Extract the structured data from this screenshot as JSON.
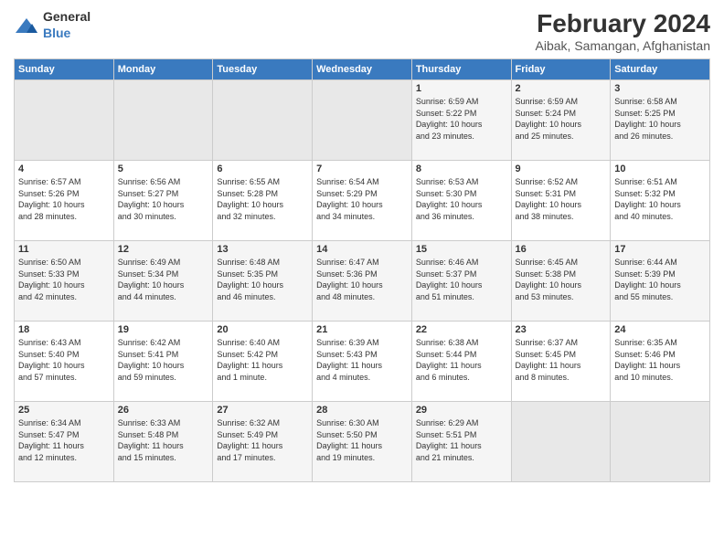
{
  "logo": {
    "general": "General",
    "blue": "Blue"
  },
  "header": {
    "month": "February 2024",
    "location": "Aibak, Samangan, Afghanistan"
  },
  "weekdays": [
    "Sunday",
    "Monday",
    "Tuesday",
    "Wednesday",
    "Thursday",
    "Friday",
    "Saturday"
  ],
  "weeks": [
    [
      {
        "day": "",
        "info": ""
      },
      {
        "day": "",
        "info": ""
      },
      {
        "day": "",
        "info": ""
      },
      {
        "day": "",
        "info": ""
      },
      {
        "day": "1",
        "info": "Sunrise: 6:59 AM\nSunset: 5:22 PM\nDaylight: 10 hours\nand 23 minutes."
      },
      {
        "day": "2",
        "info": "Sunrise: 6:59 AM\nSunset: 5:24 PM\nDaylight: 10 hours\nand 25 minutes."
      },
      {
        "day": "3",
        "info": "Sunrise: 6:58 AM\nSunset: 5:25 PM\nDaylight: 10 hours\nand 26 minutes."
      }
    ],
    [
      {
        "day": "4",
        "info": "Sunrise: 6:57 AM\nSunset: 5:26 PM\nDaylight: 10 hours\nand 28 minutes."
      },
      {
        "day": "5",
        "info": "Sunrise: 6:56 AM\nSunset: 5:27 PM\nDaylight: 10 hours\nand 30 minutes."
      },
      {
        "day": "6",
        "info": "Sunrise: 6:55 AM\nSunset: 5:28 PM\nDaylight: 10 hours\nand 32 minutes."
      },
      {
        "day": "7",
        "info": "Sunrise: 6:54 AM\nSunset: 5:29 PM\nDaylight: 10 hours\nand 34 minutes."
      },
      {
        "day": "8",
        "info": "Sunrise: 6:53 AM\nSunset: 5:30 PM\nDaylight: 10 hours\nand 36 minutes."
      },
      {
        "day": "9",
        "info": "Sunrise: 6:52 AM\nSunset: 5:31 PM\nDaylight: 10 hours\nand 38 minutes."
      },
      {
        "day": "10",
        "info": "Sunrise: 6:51 AM\nSunset: 5:32 PM\nDaylight: 10 hours\nand 40 minutes."
      }
    ],
    [
      {
        "day": "11",
        "info": "Sunrise: 6:50 AM\nSunset: 5:33 PM\nDaylight: 10 hours\nand 42 minutes."
      },
      {
        "day": "12",
        "info": "Sunrise: 6:49 AM\nSunset: 5:34 PM\nDaylight: 10 hours\nand 44 minutes."
      },
      {
        "day": "13",
        "info": "Sunrise: 6:48 AM\nSunset: 5:35 PM\nDaylight: 10 hours\nand 46 minutes."
      },
      {
        "day": "14",
        "info": "Sunrise: 6:47 AM\nSunset: 5:36 PM\nDaylight: 10 hours\nand 48 minutes."
      },
      {
        "day": "15",
        "info": "Sunrise: 6:46 AM\nSunset: 5:37 PM\nDaylight: 10 hours\nand 51 minutes."
      },
      {
        "day": "16",
        "info": "Sunrise: 6:45 AM\nSunset: 5:38 PM\nDaylight: 10 hours\nand 53 minutes."
      },
      {
        "day": "17",
        "info": "Sunrise: 6:44 AM\nSunset: 5:39 PM\nDaylight: 10 hours\nand 55 minutes."
      }
    ],
    [
      {
        "day": "18",
        "info": "Sunrise: 6:43 AM\nSunset: 5:40 PM\nDaylight: 10 hours\nand 57 minutes."
      },
      {
        "day": "19",
        "info": "Sunrise: 6:42 AM\nSunset: 5:41 PM\nDaylight: 10 hours\nand 59 minutes."
      },
      {
        "day": "20",
        "info": "Sunrise: 6:40 AM\nSunset: 5:42 PM\nDaylight: 11 hours\nand 1 minute."
      },
      {
        "day": "21",
        "info": "Sunrise: 6:39 AM\nSunset: 5:43 PM\nDaylight: 11 hours\nand 4 minutes."
      },
      {
        "day": "22",
        "info": "Sunrise: 6:38 AM\nSunset: 5:44 PM\nDaylight: 11 hours\nand 6 minutes."
      },
      {
        "day": "23",
        "info": "Sunrise: 6:37 AM\nSunset: 5:45 PM\nDaylight: 11 hours\nand 8 minutes."
      },
      {
        "day": "24",
        "info": "Sunrise: 6:35 AM\nSunset: 5:46 PM\nDaylight: 11 hours\nand 10 minutes."
      }
    ],
    [
      {
        "day": "25",
        "info": "Sunrise: 6:34 AM\nSunset: 5:47 PM\nDaylight: 11 hours\nand 12 minutes."
      },
      {
        "day": "26",
        "info": "Sunrise: 6:33 AM\nSunset: 5:48 PM\nDaylight: 11 hours\nand 15 minutes."
      },
      {
        "day": "27",
        "info": "Sunrise: 6:32 AM\nSunset: 5:49 PM\nDaylight: 11 hours\nand 17 minutes."
      },
      {
        "day": "28",
        "info": "Sunrise: 6:30 AM\nSunset: 5:50 PM\nDaylight: 11 hours\nand 19 minutes."
      },
      {
        "day": "29",
        "info": "Sunrise: 6:29 AM\nSunset: 5:51 PM\nDaylight: 11 hours\nand 21 minutes."
      },
      {
        "day": "",
        "info": ""
      },
      {
        "day": "",
        "info": ""
      }
    ]
  ]
}
